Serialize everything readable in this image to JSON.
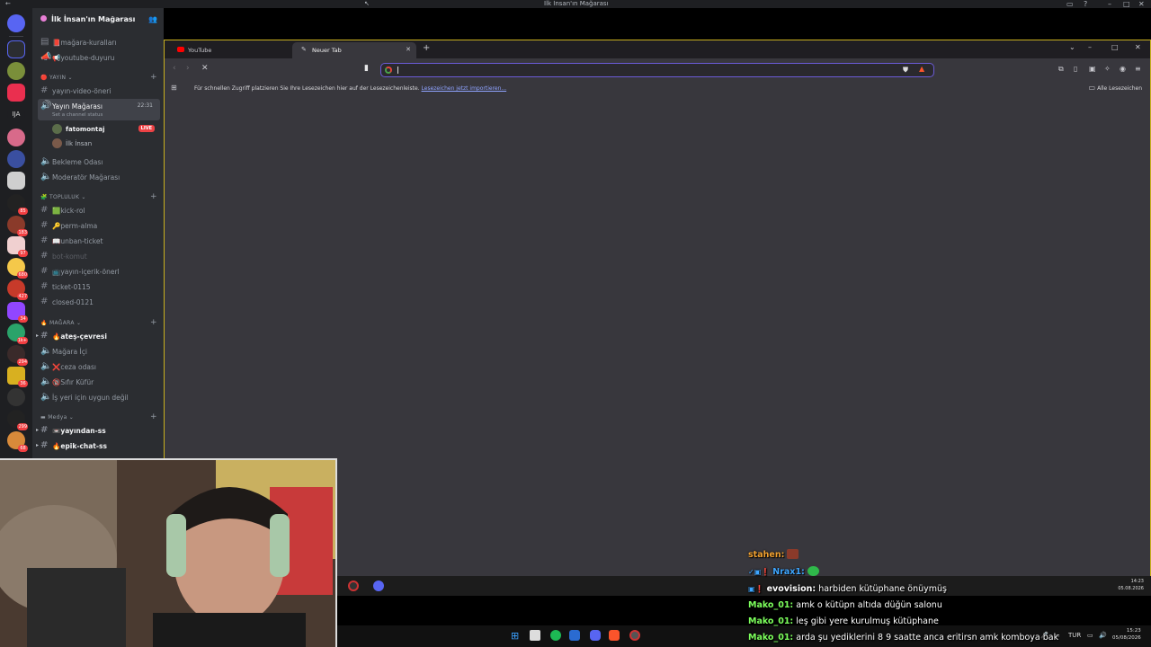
{
  "window": {
    "title": "İlk İnsan'ın Mağarası"
  },
  "guild": {
    "name": "İlk İnsan'ın Mağarası"
  },
  "server_badges": [
    "85",
    "183",
    "97",
    "680",
    "427",
    "34",
    "1k+",
    "294",
    "36",
    "299",
    "68"
  ],
  "rail_label": "IJA",
  "channels": {
    "top": [
      {
        "label": "📕mağara-kuralları",
        "type": "text"
      },
      {
        "label": "📢youtube-duyuru",
        "type": "announcement"
      }
    ],
    "yayin_category": "YAYIN",
    "yayin": [
      {
        "label": "yayın-video-öneri",
        "type": "text"
      }
    ],
    "voice_active": {
      "label": "Yayın Mağarası",
      "status": "Set a channel status",
      "time": "22:31"
    },
    "voice_users": [
      {
        "name": "fatomontaj",
        "live": "LIVE"
      },
      {
        "name": "İlk İnsan",
        "live": ""
      }
    ],
    "voice_more": [
      {
        "label": "Bekleme Odası"
      },
      {
        "label": "Moderatör Mağarası"
      }
    ],
    "topluluk_category": "TOPLULUK",
    "topluluk": [
      {
        "label": "🟩kick-rol"
      },
      {
        "label": "🔑perm-alma"
      },
      {
        "label": "📖unban-ticket"
      },
      {
        "label": "bot-komut"
      },
      {
        "label": "📺yayın-içerik-önerl"
      },
      {
        "label": "ticket-0115"
      },
      {
        "label": "closed-0121"
      }
    ],
    "magara_category": "MAĞARA",
    "magara": [
      {
        "label": "🔥ateş-çevresi"
      },
      {
        "label": "Mağara İçi"
      },
      {
        "label": "❌ceza odası"
      },
      {
        "label": "🔞Sıfır Küfür"
      },
      {
        "label": "İş yeri için uygun değil"
      }
    ],
    "medya_category": "Medya",
    "medya": [
      {
        "label": "📼yayından-ss"
      },
      {
        "label": "🔥epik-chat-ss"
      }
    ]
  },
  "browser": {
    "tabs": [
      {
        "label": "YouTube",
        "active": false
      },
      {
        "label": "Neuer Tab",
        "active": true
      }
    ],
    "address_placeholder": "",
    "bookmarks_hint": "Für schnellen Zugriff platzieren Sie Ihre Lesezeichen hier auf der Lesezeichenleiste.",
    "bookmarks_link": "Lesezeichen jetzt importieren...",
    "all_bookmarks": "Alle Lesezeichen",
    "accent": "#6b5bd8"
  },
  "inner_clock": {
    "time": "14:23",
    "date": "05.08.2026"
  },
  "outer_clock": {
    "time": "15:23",
    "date": "05/08/2026",
    "lang": "TUR"
  },
  "chat": [
    {
      "user": "stahen:",
      "message": "",
      "color": "#f0a030",
      "emote": true
    },
    {
      "user": "Nrax1:",
      "message": "",
      "color": "#3ea6ff",
      "emote": true
    },
    {
      "user": "evovision:",
      "message": "harbiden kütüphane önüymüş",
      "color": "#ffffff"
    },
    {
      "user": "Mako_01:",
      "message": "amk o kütüpn altıda düğün salonu",
      "color": "#7cff5c"
    },
    {
      "user": "Mako_01:",
      "message": "leş gibi yere kurulmuş kütüphane",
      "color": "#7cff5c"
    },
    {
      "user": "Mako_01:",
      "message": "arda şu yediklerini 8 9 saatte anca eritirsn amk komboya bak",
      "color": "#7cff5c"
    }
  ]
}
